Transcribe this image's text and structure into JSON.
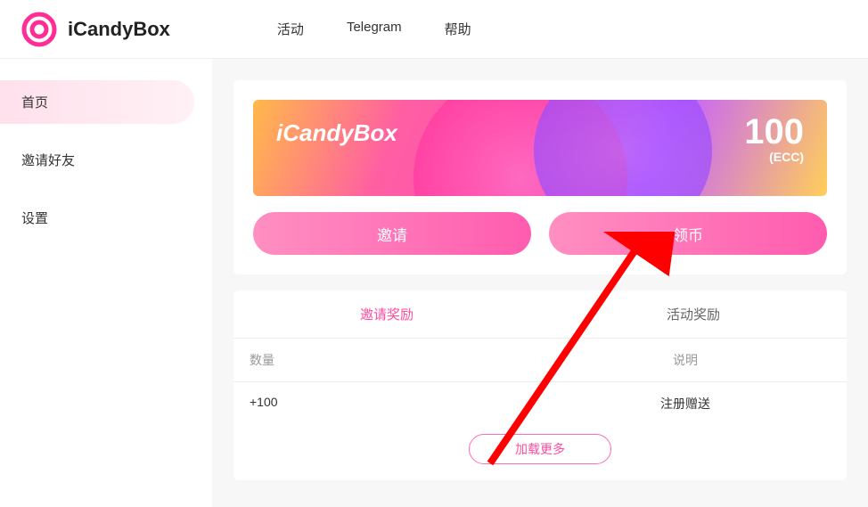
{
  "header": {
    "brand": "iCandyBox",
    "nav": [
      "活动",
      "Telegram",
      "帮助"
    ]
  },
  "sidebar": {
    "items": [
      {
        "label": "首页",
        "active": true
      },
      {
        "label": "邀请好友",
        "active": false
      },
      {
        "label": "设置",
        "active": false
      }
    ]
  },
  "banner": {
    "title": "iCandyBox",
    "amount": "100",
    "currency": "(ECC)"
  },
  "actions": {
    "invite": "邀请",
    "claim": "领币"
  },
  "rewards": {
    "tabs": [
      {
        "label": "邀请奖励",
        "active": true
      },
      {
        "label": "活动奖励",
        "active": false
      }
    ],
    "columns": {
      "qty": "数量",
      "desc": "说明"
    },
    "rows": [
      {
        "qty": "+100",
        "desc": "注册赠送"
      }
    ],
    "loadMore": "加载更多"
  },
  "colors": {
    "accent": "#ff4d9e"
  }
}
